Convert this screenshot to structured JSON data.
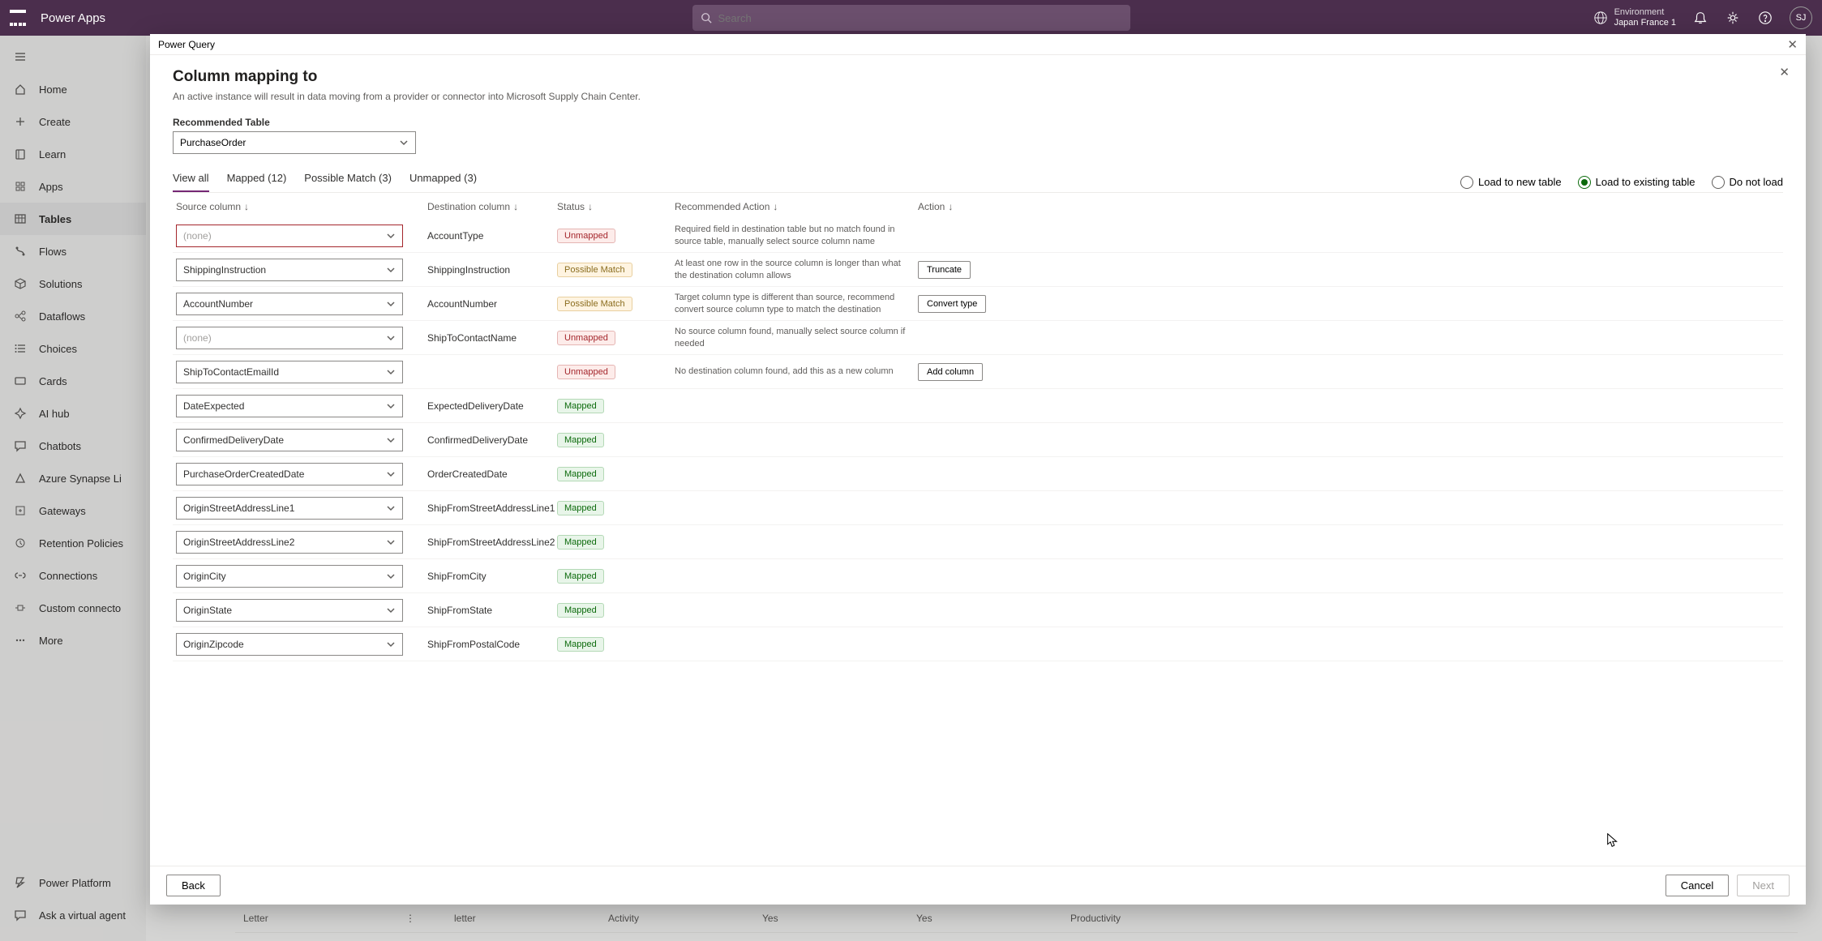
{
  "header": {
    "app_name": "Power Apps",
    "search_placeholder": "Search",
    "env_label": "Environment",
    "env_name": "Japan France 1",
    "avatar": "SJ"
  },
  "sidebar": {
    "items": [
      {
        "icon": "home",
        "label": "Home"
      },
      {
        "icon": "plus",
        "label": "Create"
      },
      {
        "icon": "book",
        "label": "Learn"
      },
      {
        "icon": "grid",
        "label": "Apps"
      },
      {
        "icon": "table",
        "label": "Tables",
        "selected": true
      },
      {
        "icon": "flow",
        "label": "Flows"
      },
      {
        "icon": "cube",
        "label": "Solutions"
      },
      {
        "icon": "dataflow",
        "label": "Dataflows"
      },
      {
        "icon": "list",
        "label": "Choices"
      },
      {
        "icon": "card",
        "label": "Cards"
      },
      {
        "icon": "ai",
        "label": "AI hub"
      },
      {
        "icon": "chat",
        "label": "Chatbots"
      },
      {
        "icon": "azure",
        "label": "Azure Synapse Li"
      },
      {
        "icon": "gateway",
        "label": "Gateways"
      },
      {
        "icon": "retention",
        "label": "Retention Policies"
      },
      {
        "icon": "conn",
        "label": "Connections"
      },
      {
        "icon": "custom",
        "label": "Custom connecto"
      },
      {
        "icon": "more",
        "label": "More"
      }
    ],
    "platform": "Power Platform",
    "virtual_agent": "Ask a virtual agent"
  },
  "modal": {
    "titlebar": "Power Query",
    "title": "Column mapping to",
    "subtitle": "An active instance will result in data moving from a provider or connector into Microsoft Supply Chain Center.",
    "rec_label": "Recommended Table",
    "rec_value": "PurchaseOrder",
    "tabs": {
      "view_all": "View all",
      "mapped": "Mapped (12)",
      "possible": "Possible Match (3)",
      "unmapped": "Unmapped (3)"
    },
    "load_opts": {
      "new_table": "Load to new table",
      "existing": "Load to existing table",
      "donot": "Do not load"
    },
    "columns": {
      "src": "Source column",
      "dst": "Destination column",
      "status": "Status",
      "rec": "Recommended  Action",
      "act": "Action"
    },
    "rows": [
      {
        "src": "(none)",
        "none": true,
        "error": true,
        "dst": "AccountType",
        "status": "Unmapped",
        "rec": "Required field in destination table but no match found in source table, manually select source column name",
        "act": ""
      },
      {
        "src": "ShippingInstruction",
        "dst": "ShippingInstruction",
        "status": "Possible  Match",
        "rec": "At least one row in the source column is longer than what the destination column allows",
        "act": "Truncate"
      },
      {
        "src": "AccountNumber",
        "dst": "AccountNumber",
        "status": "Possible  Match",
        "rec": "Target column type is different than source, recommend convert source column type to match the destination",
        "act": "Convert type"
      },
      {
        "src": "(none)",
        "none": true,
        "dst": "ShipToContactName",
        "status": "Unmapped",
        "rec": "No source column found, manually select source column if needed",
        "act": ""
      },
      {
        "src": "ShipToContactEmailId",
        "dst": "",
        "status": "Unmapped",
        "rec": "No destination column found, add this as a new column",
        "act": "Add column"
      },
      {
        "src": "DateExpected",
        "dst": "ExpectedDeliveryDate",
        "status": "Mapped",
        "rec": "",
        "act": ""
      },
      {
        "src": "ConfirmedDeliveryDate",
        "dst": "ConfirmedDeliveryDate",
        "status": "Mapped",
        "rec": "",
        "act": ""
      },
      {
        "src": "PurchaseOrderCreatedDate",
        "dst": "OrderCreatedDate",
        "status": "Mapped",
        "rec": "",
        "act": ""
      },
      {
        "src": "OriginStreetAddressLine1",
        "dst": "ShipFromStreetAddressLine1",
        "status": "Mapped",
        "rec": "",
        "act": ""
      },
      {
        "src": "OriginStreetAddressLine2",
        "dst": "ShipFromStreetAddressLine2",
        "status": "Mapped",
        "rec": "",
        "act": ""
      },
      {
        "src": "OriginCity",
        "dst": "ShipFromCity",
        "status": "Mapped",
        "rec": "",
        "act": ""
      },
      {
        "src": "OriginState",
        "dst": "ShipFromState",
        "status": "Mapped",
        "rec": "",
        "act": ""
      },
      {
        "src": "OriginZipcode",
        "dst": "ShipFromPostalCode",
        "status": "Mapped",
        "rec": "",
        "act": ""
      }
    ],
    "footer": {
      "back": "Back",
      "cancel": "Cancel",
      "next": "Next"
    }
  },
  "bg": {
    "search": "Search",
    "row_letter": {
      "name": "Letter",
      "name2": "letter",
      "type": "Activity",
      "c1": "Yes",
      "c2": "Yes",
      "c3": "Productivity"
    }
  }
}
